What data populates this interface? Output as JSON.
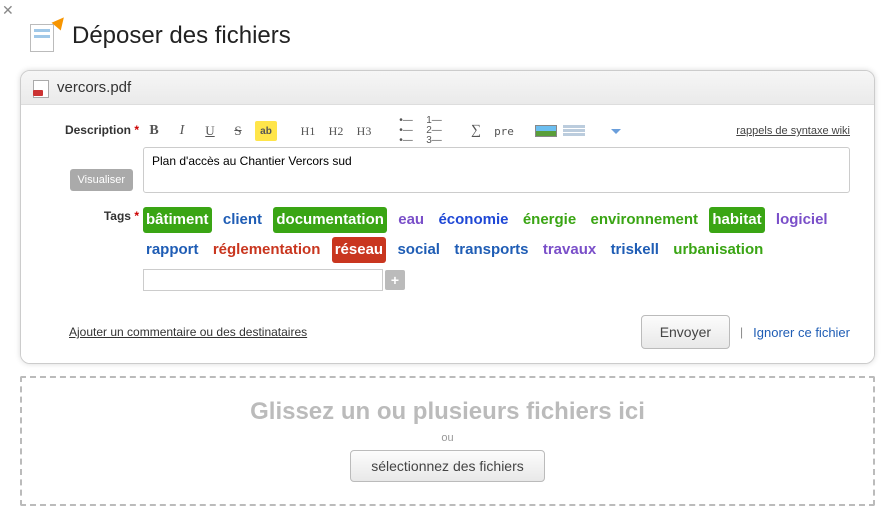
{
  "header": {
    "title": "Déposer des fichiers"
  },
  "file": {
    "name": "vercors.pdf"
  },
  "labels": {
    "description": "Description",
    "tags": "Tags",
    "visualize": "Visualiser"
  },
  "toolbar": {
    "wiki_help": "rappels de syntaxe wiki",
    "h1": "H1",
    "h2": "H2",
    "h3": "H3",
    "pre": "pre"
  },
  "description": {
    "value": "Plan d'accès au Chantier Vercors sud"
  },
  "tags": [
    {
      "name": "bâtiment",
      "color": "#3aa514",
      "selected": true
    },
    {
      "name": "client",
      "color": "#1f5db5",
      "selected": false
    },
    {
      "name": "documentation",
      "color": "#3aa514",
      "selected": true
    },
    {
      "name": "eau",
      "color": "#7a4fc9",
      "selected": false
    },
    {
      "name": "économie",
      "color": "#1f48d6",
      "selected": false
    },
    {
      "name": "énergie",
      "color": "#3aa514",
      "selected": false
    },
    {
      "name": "environnement",
      "color": "#3aa514",
      "selected": false
    },
    {
      "name": "habitat",
      "color": "#3aa514",
      "selected": true
    },
    {
      "name": "logiciel",
      "color": "#7a4fc9",
      "selected": false
    },
    {
      "name": "rapport",
      "color": "#1f5db5",
      "selected": false
    },
    {
      "name": "réglementation",
      "color": "#c9361f",
      "selected": false
    },
    {
      "name": "réseau",
      "color": "#c9361f",
      "selected": true
    },
    {
      "name": "social",
      "color": "#1f5db5",
      "selected": false
    },
    {
      "name": "transports",
      "color": "#1f5db5",
      "selected": false
    },
    {
      "name": "travaux",
      "color": "#7a4fc9",
      "selected": false
    },
    {
      "name": "triskell",
      "color": "#1f5db5",
      "selected": false
    },
    {
      "name": "urbanisation",
      "color": "#3aa514",
      "selected": false
    }
  ],
  "bottom": {
    "add_comment": "Ajouter un commentaire ou des destinataires",
    "send": "Envoyer",
    "ignore": "Ignorer ce fichier"
  },
  "dropzone": {
    "title": "Glissez un ou plusieurs fichiers ici",
    "or": "ou",
    "select": "sélectionnez des fichiers"
  }
}
